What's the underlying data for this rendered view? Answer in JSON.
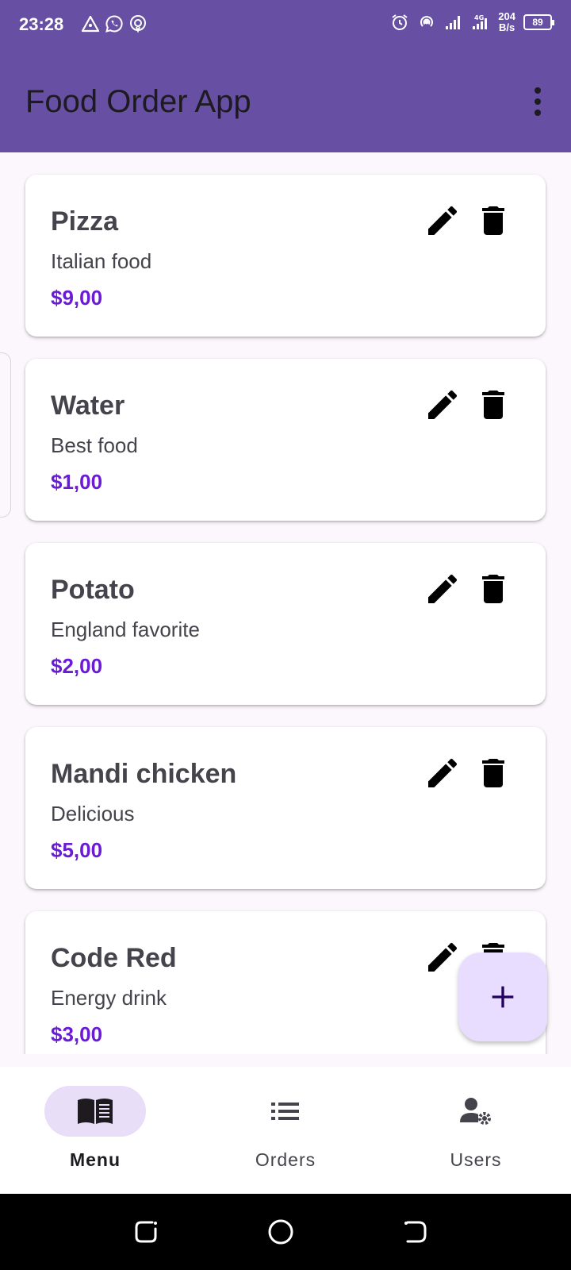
{
  "status_bar": {
    "time": "23:28",
    "left_icons": [
      "triangle-alert-icon",
      "whatsapp-icon",
      "podcast-icon"
    ],
    "right_icons": [
      "alarm-icon",
      "hotspot-icon",
      "signal-icon",
      "signal-4g-icon"
    ],
    "net_speed_value": "204",
    "net_speed_unit": "B/s",
    "battery": "89"
  },
  "app_bar": {
    "title": "Food Order App",
    "menu_icon": "more-vert-icon"
  },
  "menu_items": [
    {
      "name": "Pizza",
      "description": "Italian food",
      "price": "$9,00"
    },
    {
      "name": "Water",
      "description": "Best food",
      "price": "$1,00"
    },
    {
      "name": "Potato",
      "description": "England favorite",
      "price": "$2,00"
    },
    {
      "name": "Mandi chicken",
      "description": "Delicious",
      "price": "$5,00"
    },
    {
      "name": "Code Red",
      "description": "Energy drink",
      "price": "$3,00"
    }
  ],
  "fab": {
    "icon": "add-icon"
  },
  "bottom_nav": {
    "items": [
      {
        "label": "Menu",
        "icon": "menu-book-icon",
        "active": true
      },
      {
        "label": "Orders",
        "icon": "list-icon",
        "active": false
      },
      {
        "label": "Users",
        "icon": "manage-accounts-icon",
        "active": false
      }
    ]
  },
  "colors": {
    "primary": "#6750a4",
    "price": "#6a1bd6",
    "fab_bg": "#e8ddff",
    "nav_active_bg": "#e8def8"
  }
}
